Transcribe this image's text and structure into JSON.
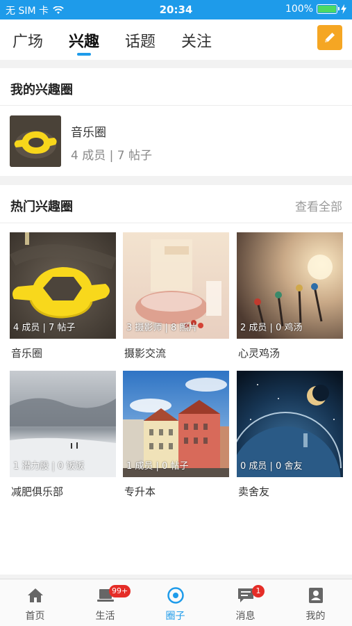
{
  "status_bar": {
    "carrier": "无 SIM 卡",
    "time": "20:34",
    "battery": "100%",
    "battery_level": 1.0
  },
  "top_tabs": [
    {
      "label": "广场",
      "active": false
    },
    {
      "label": "兴趣",
      "active": true
    },
    {
      "label": "话题",
      "active": false
    },
    {
      "label": "关注",
      "active": false
    }
  ],
  "colors": {
    "accent": "#1e9bea",
    "edit_button": "#f5a623",
    "badge": "#e52d27"
  },
  "my_circles": {
    "title": "我的兴趣圈",
    "items": [
      {
        "name": "音乐圈",
        "stats": "4 成员 | 7 帖子"
      }
    ]
  },
  "hot_circles": {
    "title": "热门兴趣圈",
    "view_all": "查看全部",
    "items": [
      {
        "name": "音乐圈",
        "stats": "4 成员 | 7 帖子"
      },
      {
        "name": "摄影交流",
        "stats": "3 摄影师 | 8 照片"
      },
      {
        "name": "心灵鸡汤",
        "stats": "2 成员 | 0 鸡汤"
      },
      {
        "name": "减肥俱乐部",
        "stats": "1 潜力股 | 0 饭饭"
      },
      {
        "name": "专升本",
        "stats": "1 成员 | 0 帖子"
      },
      {
        "name": "卖舍友",
        "stats": "0 成员 | 0 舍友"
      }
    ]
  },
  "bottom_tabs": [
    {
      "label": "首页",
      "icon": "home-icon",
      "badge": ""
    },
    {
      "label": "生活",
      "icon": "laptop-icon",
      "badge": "99+"
    },
    {
      "label": "圈子",
      "icon": "circle-target-icon",
      "badge": "",
      "active": true
    },
    {
      "label": "消息",
      "icon": "chat-icon",
      "badge": "1"
    },
    {
      "label": "我的",
      "icon": "profile-icon",
      "badge": ""
    }
  ]
}
